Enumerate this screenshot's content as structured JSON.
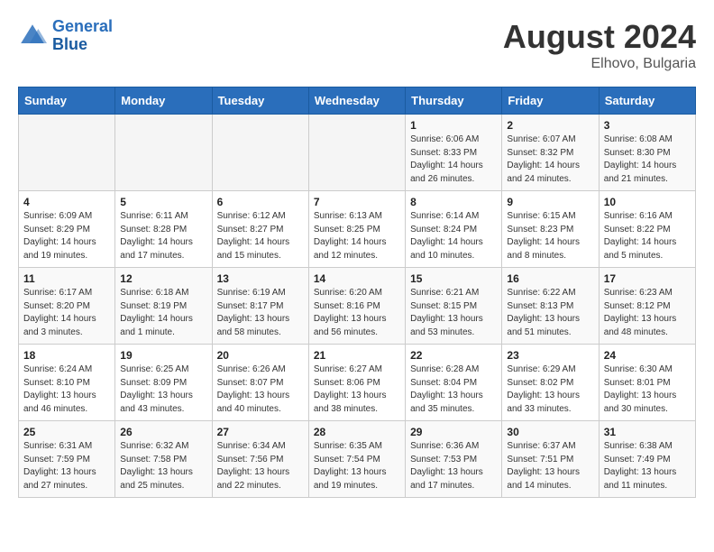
{
  "header": {
    "logo_line1": "General",
    "logo_line2": "Blue",
    "title": "August 2024",
    "subtitle": "Elhovo, Bulgaria"
  },
  "days_of_week": [
    "Sunday",
    "Monday",
    "Tuesday",
    "Wednesday",
    "Thursday",
    "Friday",
    "Saturday"
  ],
  "weeks": [
    [
      {
        "day": "",
        "detail": ""
      },
      {
        "day": "",
        "detail": ""
      },
      {
        "day": "",
        "detail": ""
      },
      {
        "day": "",
        "detail": ""
      },
      {
        "day": "1",
        "detail": "Sunrise: 6:06 AM\nSunset: 8:33 PM\nDaylight: 14 hours\nand 26 minutes."
      },
      {
        "day": "2",
        "detail": "Sunrise: 6:07 AM\nSunset: 8:32 PM\nDaylight: 14 hours\nand 24 minutes."
      },
      {
        "day": "3",
        "detail": "Sunrise: 6:08 AM\nSunset: 8:30 PM\nDaylight: 14 hours\nand 21 minutes."
      }
    ],
    [
      {
        "day": "4",
        "detail": "Sunrise: 6:09 AM\nSunset: 8:29 PM\nDaylight: 14 hours\nand 19 minutes."
      },
      {
        "day": "5",
        "detail": "Sunrise: 6:11 AM\nSunset: 8:28 PM\nDaylight: 14 hours\nand 17 minutes."
      },
      {
        "day": "6",
        "detail": "Sunrise: 6:12 AM\nSunset: 8:27 PM\nDaylight: 14 hours\nand 15 minutes."
      },
      {
        "day": "7",
        "detail": "Sunrise: 6:13 AM\nSunset: 8:25 PM\nDaylight: 14 hours\nand 12 minutes."
      },
      {
        "day": "8",
        "detail": "Sunrise: 6:14 AM\nSunset: 8:24 PM\nDaylight: 14 hours\nand 10 minutes."
      },
      {
        "day": "9",
        "detail": "Sunrise: 6:15 AM\nSunset: 8:23 PM\nDaylight: 14 hours\nand 8 minutes."
      },
      {
        "day": "10",
        "detail": "Sunrise: 6:16 AM\nSunset: 8:22 PM\nDaylight: 14 hours\nand 5 minutes."
      }
    ],
    [
      {
        "day": "11",
        "detail": "Sunrise: 6:17 AM\nSunset: 8:20 PM\nDaylight: 14 hours\nand 3 minutes."
      },
      {
        "day": "12",
        "detail": "Sunrise: 6:18 AM\nSunset: 8:19 PM\nDaylight: 14 hours\nand 1 minute."
      },
      {
        "day": "13",
        "detail": "Sunrise: 6:19 AM\nSunset: 8:17 PM\nDaylight: 13 hours\nand 58 minutes."
      },
      {
        "day": "14",
        "detail": "Sunrise: 6:20 AM\nSunset: 8:16 PM\nDaylight: 13 hours\nand 56 minutes."
      },
      {
        "day": "15",
        "detail": "Sunrise: 6:21 AM\nSunset: 8:15 PM\nDaylight: 13 hours\nand 53 minutes."
      },
      {
        "day": "16",
        "detail": "Sunrise: 6:22 AM\nSunset: 8:13 PM\nDaylight: 13 hours\nand 51 minutes."
      },
      {
        "day": "17",
        "detail": "Sunrise: 6:23 AM\nSunset: 8:12 PM\nDaylight: 13 hours\nand 48 minutes."
      }
    ],
    [
      {
        "day": "18",
        "detail": "Sunrise: 6:24 AM\nSunset: 8:10 PM\nDaylight: 13 hours\nand 46 minutes."
      },
      {
        "day": "19",
        "detail": "Sunrise: 6:25 AM\nSunset: 8:09 PM\nDaylight: 13 hours\nand 43 minutes."
      },
      {
        "day": "20",
        "detail": "Sunrise: 6:26 AM\nSunset: 8:07 PM\nDaylight: 13 hours\nand 40 minutes."
      },
      {
        "day": "21",
        "detail": "Sunrise: 6:27 AM\nSunset: 8:06 PM\nDaylight: 13 hours\nand 38 minutes."
      },
      {
        "day": "22",
        "detail": "Sunrise: 6:28 AM\nSunset: 8:04 PM\nDaylight: 13 hours\nand 35 minutes."
      },
      {
        "day": "23",
        "detail": "Sunrise: 6:29 AM\nSunset: 8:02 PM\nDaylight: 13 hours\nand 33 minutes."
      },
      {
        "day": "24",
        "detail": "Sunrise: 6:30 AM\nSunset: 8:01 PM\nDaylight: 13 hours\nand 30 minutes."
      }
    ],
    [
      {
        "day": "25",
        "detail": "Sunrise: 6:31 AM\nSunset: 7:59 PM\nDaylight: 13 hours\nand 27 minutes."
      },
      {
        "day": "26",
        "detail": "Sunrise: 6:32 AM\nSunset: 7:58 PM\nDaylight: 13 hours\nand 25 minutes."
      },
      {
        "day": "27",
        "detail": "Sunrise: 6:34 AM\nSunset: 7:56 PM\nDaylight: 13 hours\nand 22 minutes."
      },
      {
        "day": "28",
        "detail": "Sunrise: 6:35 AM\nSunset: 7:54 PM\nDaylight: 13 hours\nand 19 minutes."
      },
      {
        "day": "29",
        "detail": "Sunrise: 6:36 AM\nSunset: 7:53 PM\nDaylight: 13 hours\nand 17 minutes."
      },
      {
        "day": "30",
        "detail": "Sunrise: 6:37 AM\nSunset: 7:51 PM\nDaylight: 13 hours\nand 14 minutes."
      },
      {
        "day": "31",
        "detail": "Sunrise: 6:38 AM\nSunset: 7:49 PM\nDaylight: 13 hours\nand 11 minutes."
      }
    ]
  ]
}
